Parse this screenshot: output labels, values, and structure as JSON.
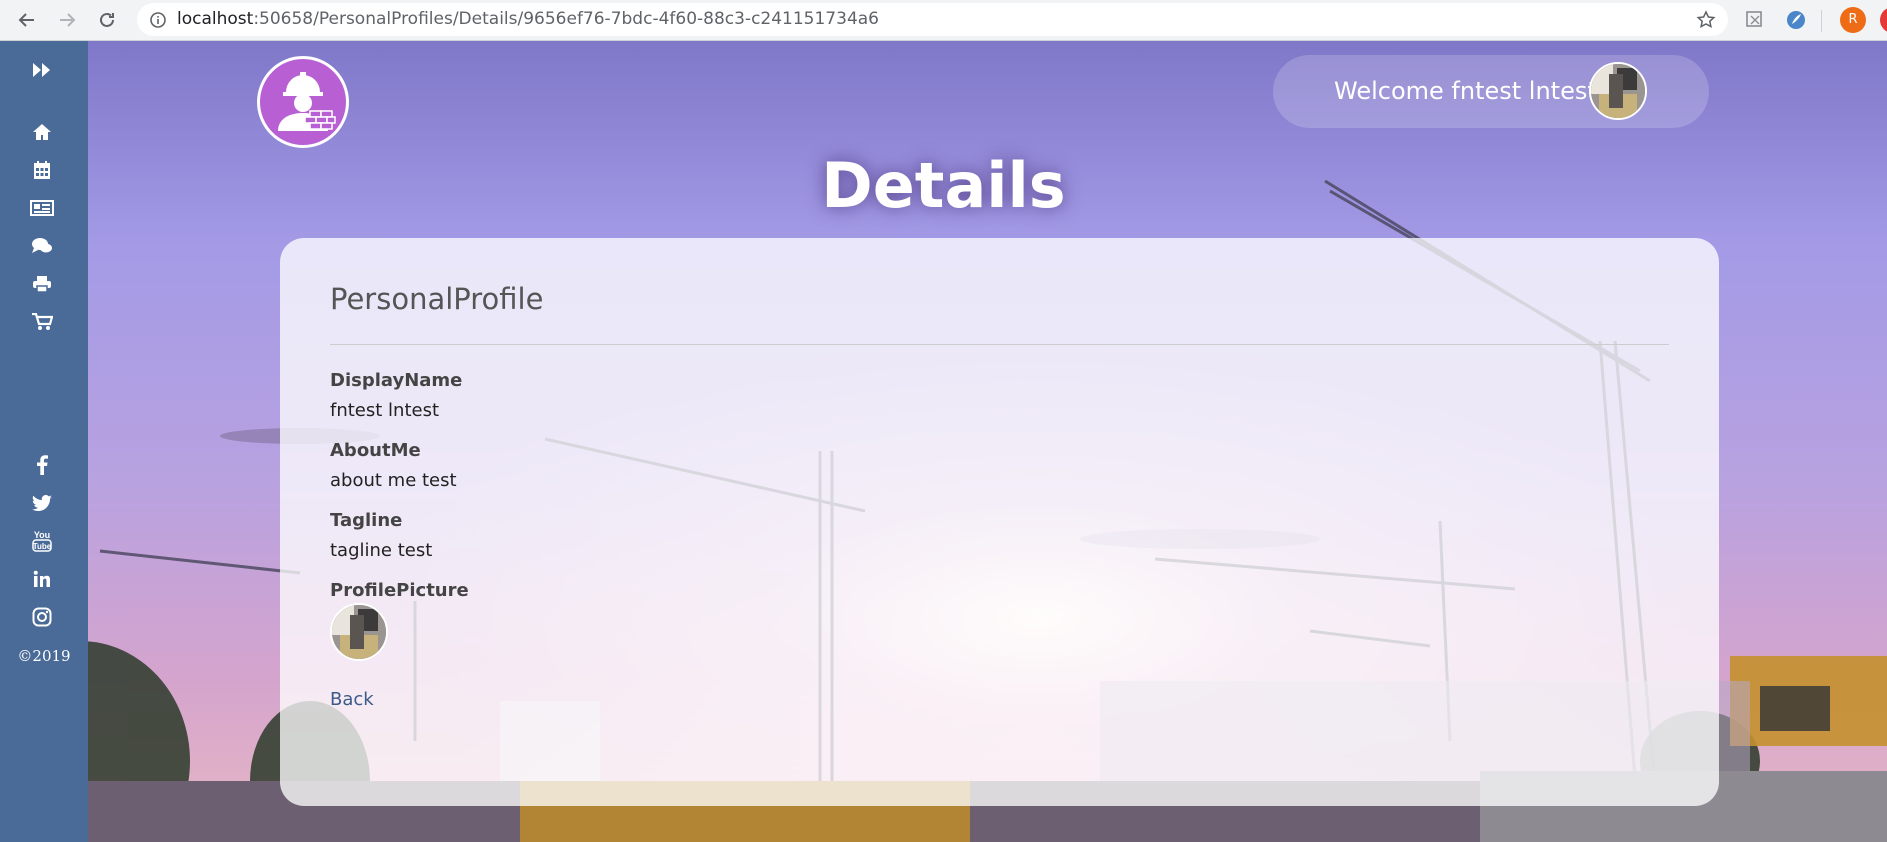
{
  "browser": {
    "url_host": "localhost",
    "url_rest": ":50658/PersonalProfiles/Details/9656ef76-7bdc-4f60-88c3-c241151734a6",
    "profile_initial": "R",
    "icons": [
      "back-arrow-icon",
      "forward-arrow-icon",
      "reload-icon",
      "info-icon",
      "star-icon"
    ]
  },
  "sidebar": {
    "top_icons": [
      "expand-icon",
      "home-icon",
      "calendar-icon",
      "newspaper-icon",
      "comments-icon",
      "print-icon",
      "cart-icon"
    ],
    "social_icons": [
      "facebook-icon",
      "twitter-icon",
      "youtube-icon",
      "linkedin-icon",
      "instagram-icon"
    ],
    "copyright": "©2019",
    "background": "#4a6b97"
  },
  "header": {
    "welcome": "Welcome fntest lntest",
    "logo_color": "#b860d3"
  },
  "page_title": "Details",
  "card": {
    "heading": "PersonalProfile",
    "fields": [
      {
        "label": "DisplayName",
        "value": "fntest lntest"
      },
      {
        "label": "AboutMe",
        "value": "about me test"
      },
      {
        "label": "Tagline",
        "value": "tagline test"
      },
      {
        "label": "ProfilePicture",
        "value": ""
      }
    ],
    "back_link": "Back"
  }
}
